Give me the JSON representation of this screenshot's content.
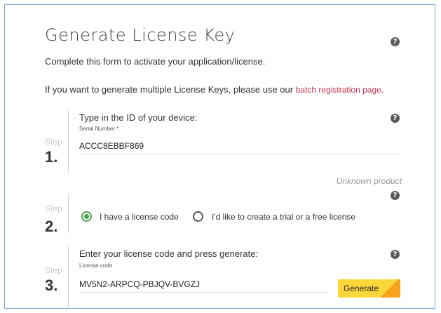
{
  "page": {
    "title": "Generate License Key",
    "intro": "Complete this form to activate your application/license.",
    "batch_text": "If you want to generate multiple License Keys, please use our ",
    "batch_link": "batch registration page",
    "batch_period": "."
  },
  "step_word": "Step",
  "step1": {
    "number": "1.",
    "heading": "Type in the ID of your device:",
    "field_label": "Serial Number *",
    "field_value": "ACCC8EBBF869",
    "status": "Unknown product"
  },
  "step2": {
    "number": "2.",
    "option1": "I have a license code",
    "option2": "I'd like to create a trial or a free license",
    "selected": "option1"
  },
  "step3": {
    "number": "3.",
    "heading": "Enter your license code and press generate:",
    "field_label": "License code",
    "field_value": "MV5N2-ARPCQ-PBJQV-BVGZJ",
    "button": "Generate"
  },
  "icons": {
    "help": "question-circle-icon"
  },
  "colors": {
    "link": "#c8324e",
    "radio_selected": "#4aa34a",
    "button": "#fcd73a",
    "button_accent": "#f6a21c"
  }
}
